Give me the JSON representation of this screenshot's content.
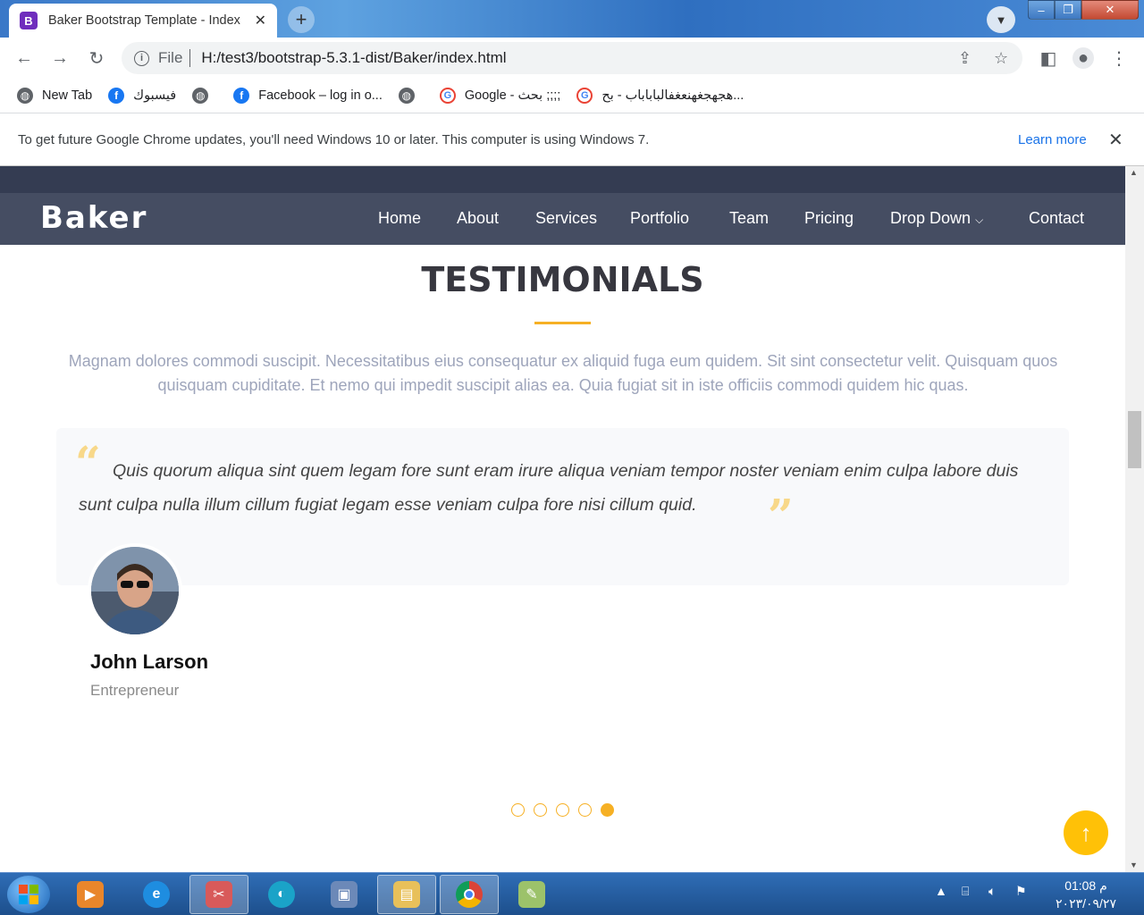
{
  "browser": {
    "tab_title": "Baker Bootstrap Template - Index",
    "tab_favicon": "B",
    "url_scheme_label": "File",
    "url": "H:/test3/bootstrap-5.3.1-dist/Baker/index.html",
    "bookmarks": [
      {
        "label": "New Tab",
        "icon": "globe-icon"
      },
      {
        "label": "فيسبوك",
        "icon": "facebook-icon"
      },
      {
        "label": "",
        "icon": "globe-icon"
      },
      {
        "label": "Facebook – log in o...",
        "icon": "facebook-icon"
      },
      {
        "label": "",
        "icon": "globe-icon"
      },
      {
        "label": "Google - بحث ;;;;",
        "icon": "google-icon"
      },
      {
        "label": "هجهجغهنعغفالباباباب - بح...",
        "icon": "google-icon"
      }
    ],
    "infobar_text": "To get future Google Chrome updates, you'll need Windows 10 or later. This computer is using Windows 7.",
    "infobar_link": "Learn more"
  },
  "site": {
    "logo": "Baker",
    "nav": [
      "Home",
      "About",
      "Services",
      "Portfolio",
      "Team",
      "Pricing",
      "Drop Down",
      "Contact"
    ],
    "section_title": "TESTIMONIALS",
    "section_desc": "Magnam dolores commodi suscipit. Necessitatibus eius consequatur ex aliquid fuga eum quidem. Sit sint consectetur velit. Quisquam quos quisquam cupiditate. Et nemo qui impedit suscipit alias ea. Quia fugiat sit in iste officiis commodi quidem hic quas.",
    "testimonial": {
      "quote": "Quis quorum aliqua sint quem legam fore sunt eram irure aliqua veniam tempor noster veniam enim culpa labore duis sunt culpa nulla illum cillum fugiat legam esse veniam culpa fore nisi cillum quid.",
      "name": "John Larson",
      "role": "Entrepreneur"
    },
    "slider_dots": 5,
    "active_dot": 5
  },
  "taskbar": {
    "time": "01:08 م",
    "date": "٢٠٢٣/٠٩/٢٧"
  },
  "colors": {
    "accent": "#f6b024",
    "header": "#454d62",
    "back_to_top": "#ffc107"
  }
}
